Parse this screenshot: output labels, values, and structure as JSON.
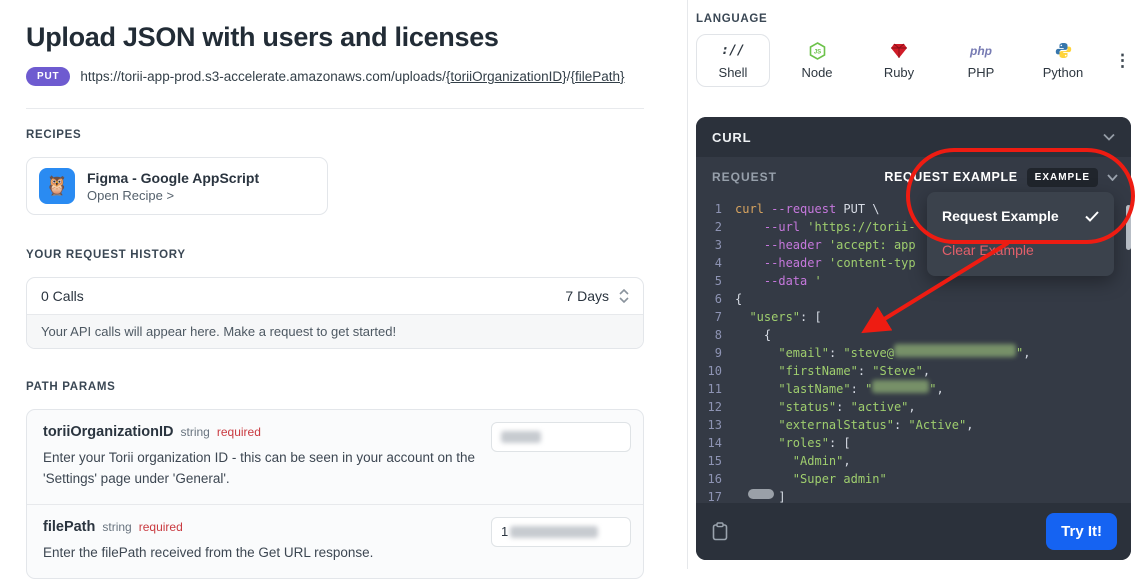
{
  "colors": {
    "method_badge": "#6e5bd0",
    "try_button": "#1563f2",
    "annotation_red": "#ee1c12",
    "required_red": "#c93a40",
    "code_bg": "#343a45",
    "code_bar_bg": "#2b313b",
    "token_function": "#d7a35f",
    "token_flag": "#c678dd",
    "token_string": "#9fce6e",
    "recipe_icon_bg": "#2a8bf2"
  },
  "page": {
    "title": "Upload JSON with users and licenses",
    "method": "PUT",
    "url_prefix": "https://torii-app-prod.s3-accelerate.amazonaws.com/uploads/",
    "url_param1": "{toriiOrganizationID}",
    "url_separator": "/",
    "url_param2": "{filePath}"
  },
  "recipes": {
    "header": "RECIPES",
    "item": {
      "icon": "owl-emoji",
      "icon_glyph": "🦉",
      "title": "Figma - Google AppScript",
      "link": "Open Recipe >"
    }
  },
  "history": {
    "header": "YOUR REQUEST HISTORY",
    "calls": "0 Calls",
    "range": "7 Days",
    "empty_message": "Your API calls will appear here. Make a request to get started!"
  },
  "path_params": {
    "header": "PATH PARAMS",
    "params": [
      {
        "name": "toriiOrganizationID",
        "type": "string",
        "required": "required",
        "description": "Enter your Torii organization ID - this can be seen in your account on the 'Settings' page under 'General'.",
        "value": ""
      },
      {
        "name": "filePath",
        "type": "string",
        "required": "required",
        "description": "Enter the filePath received from the Get URL response.",
        "value": "1"
      }
    ]
  },
  "language": {
    "header": "LANGUAGE",
    "tabs": [
      {
        "label": "Shell",
        "icon": "shell",
        "selected": true
      },
      {
        "label": "Node",
        "icon": "node",
        "selected": false
      },
      {
        "label": "Ruby",
        "icon": "ruby",
        "selected": false
      },
      {
        "label": "PHP",
        "icon": "php",
        "selected": false
      },
      {
        "label": "Python",
        "icon": "python",
        "selected": false
      }
    ]
  },
  "code_panel": {
    "title": "CURL",
    "request_label": "REQUEST",
    "example_selector": {
      "label": "REQUEST EXAMPLE",
      "badge": "EXAMPLE"
    },
    "dropdown": {
      "items": [
        {
          "label": "Request Example",
          "checked": true,
          "style": "checked-item"
        },
        {
          "label": "Clear Example",
          "checked": false,
          "style": "danger-item"
        }
      ]
    },
    "try_button": "Try It!",
    "lines": [
      {
        "n": "1",
        "tokens": [
          {
            "c": "fn",
            "t": "curl"
          },
          {
            "c": "pl",
            "t": " "
          },
          {
            "c": "kw",
            "t": "--request"
          },
          {
            "c": "pl",
            "t": " PUT \\"
          }
        ]
      },
      {
        "n": "2",
        "tokens": [
          {
            "c": "pl",
            "t": "    "
          },
          {
            "c": "kw",
            "t": "--url"
          },
          {
            "c": "pl",
            "t": " "
          },
          {
            "c": "str",
            "t": "'https://torii-"
          }
        ]
      },
      {
        "n": "3",
        "tokens": [
          {
            "c": "pl",
            "t": "    "
          },
          {
            "c": "kw",
            "t": "--header"
          },
          {
            "c": "pl",
            "t": " "
          },
          {
            "c": "str",
            "t": "'accept: app"
          }
        ]
      },
      {
        "n": "4",
        "tokens": [
          {
            "c": "pl",
            "t": "    "
          },
          {
            "c": "kw",
            "t": "--header"
          },
          {
            "c": "pl",
            "t": " "
          },
          {
            "c": "str",
            "t": "'content-typ"
          }
        ]
      },
      {
        "n": "5",
        "tokens": [
          {
            "c": "pl",
            "t": "    "
          },
          {
            "c": "kw",
            "t": "--data"
          },
          {
            "c": "pl",
            "t": " "
          },
          {
            "c": "str",
            "t": "'"
          }
        ]
      },
      {
        "n": "6",
        "tokens": [
          {
            "c": "pl",
            "t": "{"
          }
        ]
      },
      {
        "n": "7",
        "tokens": [
          {
            "c": "pl",
            "t": "  "
          },
          {
            "c": "str",
            "t": "\"users\""
          },
          {
            "c": "pl",
            "t": ": ["
          }
        ]
      },
      {
        "n": "8",
        "tokens": [
          {
            "c": "pl",
            "t": "    {"
          }
        ]
      },
      {
        "n": "9",
        "tokens": [
          {
            "c": "pl",
            "t": "      "
          },
          {
            "c": "str",
            "t": "\"email\""
          },
          {
            "c": "pl",
            "t": ": "
          },
          {
            "c": "str",
            "t": "\"steve@"
          },
          {
            "c": "blur",
            "w": 122
          },
          {
            "c": "str",
            "t": "\""
          },
          {
            "c": "pl",
            "t": ","
          }
        ]
      },
      {
        "n": "10",
        "tokens": [
          {
            "c": "pl",
            "t": "      "
          },
          {
            "c": "str",
            "t": "\"firstName\""
          },
          {
            "c": "pl",
            "t": ": "
          },
          {
            "c": "str",
            "t": "\"Steve\""
          },
          {
            "c": "pl",
            "t": ","
          }
        ]
      },
      {
        "n": "11",
        "tokens": [
          {
            "c": "pl",
            "t": "      "
          },
          {
            "c": "str",
            "t": "\"lastName\""
          },
          {
            "c": "pl",
            "t": ": "
          },
          {
            "c": "str",
            "t": "\""
          },
          {
            "c": "blur",
            "w": 57
          },
          {
            "c": "str",
            "t": "\""
          },
          {
            "c": "pl",
            "t": ","
          }
        ]
      },
      {
        "n": "12",
        "tokens": [
          {
            "c": "pl",
            "t": "      "
          },
          {
            "c": "str",
            "t": "\"status\""
          },
          {
            "c": "pl",
            "t": ": "
          },
          {
            "c": "str",
            "t": "\"active\""
          },
          {
            "c": "pl",
            "t": ","
          }
        ]
      },
      {
        "n": "13",
        "tokens": [
          {
            "c": "pl",
            "t": "      "
          },
          {
            "c": "str",
            "t": "\"externalStatus\""
          },
          {
            "c": "pl",
            "t": ": "
          },
          {
            "c": "str",
            "t": "\"Active\""
          },
          {
            "c": "pl",
            "t": ","
          }
        ]
      },
      {
        "n": "14",
        "tokens": [
          {
            "c": "pl",
            "t": "      "
          },
          {
            "c": "str",
            "t": "\"roles\""
          },
          {
            "c": "pl",
            "t": ": ["
          }
        ]
      },
      {
        "n": "15",
        "tokens": [
          {
            "c": "pl",
            "t": "        "
          },
          {
            "c": "str",
            "t": "\"Admin\""
          },
          {
            "c": "pl",
            "t": ","
          }
        ]
      },
      {
        "n": "16",
        "tokens": [
          {
            "c": "pl",
            "t": "        "
          },
          {
            "c": "str",
            "t": "\"Super admin\""
          }
        ]
      },
      {
        "n": "17",
        "tokens": [
          {
            "c": "pl",
            "t": "      ]"
          }
        ]
      }
    ]
  }
}
